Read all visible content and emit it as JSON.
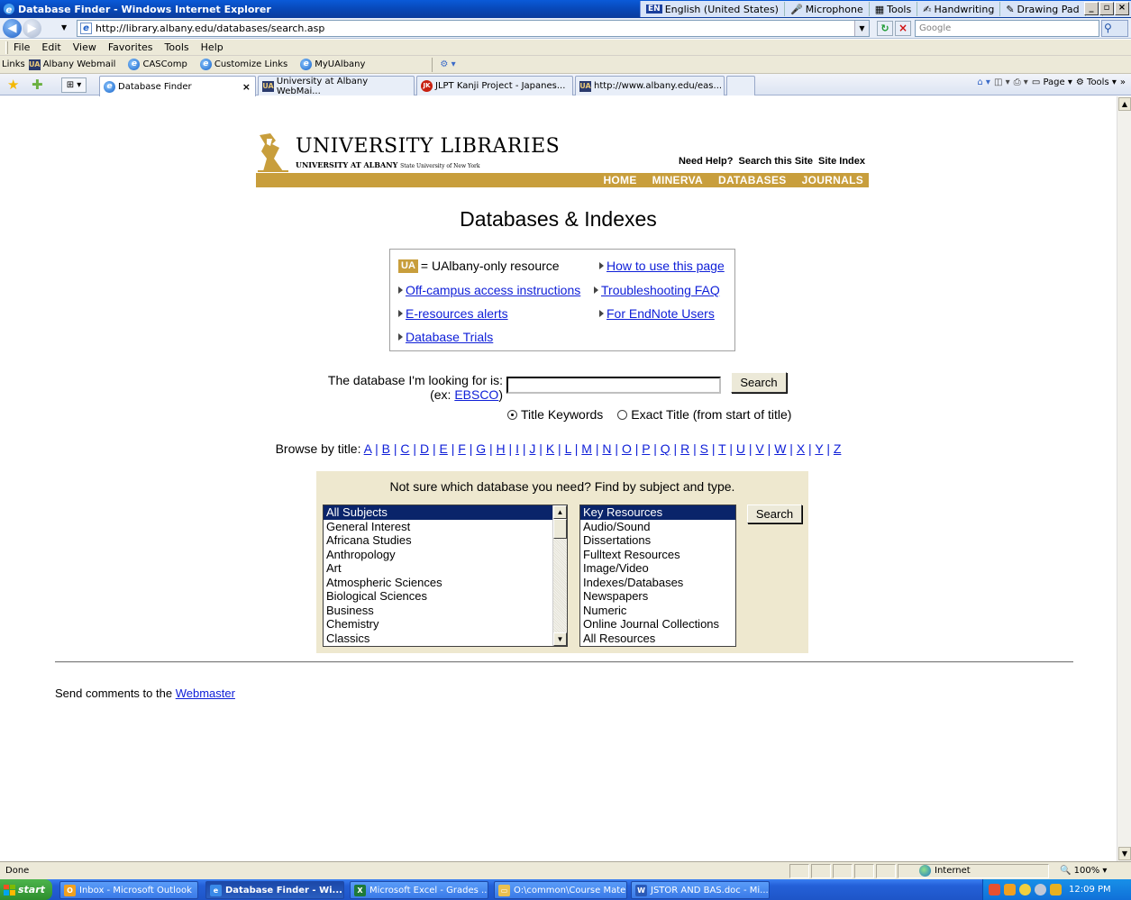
{
  "window": {
    "title": "Database Finder - Windows Internet Explorer",
    "language_bar": {
      "lang_code": "EN",
      "language": "English (United States)",
      "microphone": "Microphone",
      "tools": "Tools",
      "handwriting": "Handwriting",
      "drawing_pad": "Drawing Pad"
    }
  },
  "address_bar": {
    "url": "http://library.albany.edu/databases/search.asp",
    "search_placeholder": "Google"
  },
  "menu": {
    "items": [
      "File",
      "Edit",
      "View",
      "Favorites",
      "Tools",
      "Help"
    ]
  },
  "links_bar": {
    "label": "Links",
    "items": [
      "Albany Webmail",
      "CASComp",
      "Customize Links",
      "MyUAlbany"
    ]
  },
  "tabs": [
    {
      "label": "Database Finder",
      "active": true
    },
    {
      "label": "University at Albany WebMai...",
      "active": false
    },
    {
      "label": "JLPT Kanji Project - Japanes...",
      "active": false
    },
    {
      "label": "http://www.albany.edu/eas...",
      "active": false
    }
  ],
  "command_bar": {
    "page": "Page",
    "tools": "Tools"
  },
  "banner": {
    "title": "UNIVERSITY LIBRARIES",
    "subtitle": "UNIVERSITY AT ALBANY",
    "subtitle_small": "State University of New York",
    "top_links": [
      "Need Help?",
      "Search this Site",
      "Site Index"
    ],
    "nav": [
      "HOME",
      "MINERVA",
      "DATABASES",
      "JOURNALS"
    ]
  },
  "page": {
    "title": "Databases & Indexes",
    "info": {
      "ua_badge": "UA",
      "ua_text": "= UAlbany-only resource",
      "how_to": "How to use this page",
      "off_campus": "Off-campus access instructions",
      "troubleshooting": "Troubleshooting FAQ",
      "alerts": "E-resources alerts",
      "endnote": "For EndNote Users",
      "trials": "Database Trials"
    },
    "search": {
      "label": "The database I'm looking for is:",
      "example_prefix": "(ex:",
      "example_link": "EBSCO",
      "example_suffix": ")",
      "input_value": "",
      "button": "Search",
      "radio_title_keywords": "Title Keywords",
      "radio_exact_title": "Exact Title (from start of title)",
      "selected_radio": "Title Keywords"
    },
    "browse": {
      "label": "Browse by title:",
      "letters": [
        "A",
        "B",
        "C",
        "D",
        "E",
        "F",
        "G",
        "H",
        "I",
        "J",
        "K",
        "L",
        "M",
        "N",
        "O",
        "P",
        "Q",
        "R",
        "S",
        "T",
        "U",
        "V",
        "W",
        "X",
        "Y",
        "Z"
      ]
    },
    "finder": {
      "heading": "Not sure which database you need? Find by subject and type.",
      "subjects": [
        "All Subjects",
        "General Interest",
        "Africana Studies",
        "Anthropology",
        "Art",
        "Atmospheric Sciences",
        "Biological Sciences",
        "Business",
        "Chemistry",
        "Classics"
      ],
      "types": [
        "Key Resources",
        "Audio/Sound",
        "Dissertations",
        "Fulltext Resources",
        "Image/Video",
        "Indexes/Databases",
        "Newspapers",
        "Numeric",
        "Online Journal Collections",
        "All Resources"
      ],
      "button": "Search"
    },
    "footer": {
      "text": "Send comments to the",
      "link": "Webmaster"
    }
  },
  "status_bar": {
    "status": "Done",
    "zone": "Internet",
    "zoom": "100%"
  },
  "taskbar": {
    "start": "start",
    "buttons": [
      {
        "label": "Inbox - Microsoft Outlook",
        "active": false
      },
      {
        "label": "Database Finder - Wi...",
        "active": true
      },
      {
        "label": "Microsoft Excel - Grades ...",
        "active": false
      },
      {
        "label": "O:\\common\\Course Mate...",
        "active": false
      },
      {
        "label": "JSTOR AND BAS.doc - Mi...",
        "active": false
      }
    ],
    "clock": "12:09 PM"
  },
  "colors": {
    "library_gold": "#c89e3c",
    "link_blue": "#1020d8",
    "finder_bg": "#eee8cf",
    "list_selection": "#0a246a"
  }
}
